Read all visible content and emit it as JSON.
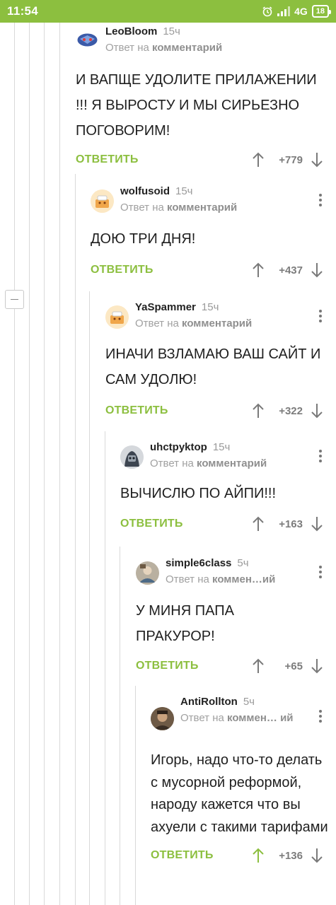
{
  "status_bar": {
    "time": "11:54",
    "network": "4G",
    "battery": "18"
  },
  "comments": [
    {
      "nick": "LeoBloom",
      "time": "15ч",
      "reply_prefix": "Ответ на",
      "reply_target": "комментарий",
      "text": "И ВАПЩЕ УДОЛИТЕ ПРИЛАЖЕНИИ !!! Я ВЫРОСТУ И МЫ СИРЬЕЗНО ПОГОВОРИМ!",
      "reply_label": "ОТВЕТИТЬ",
      "rating": "+779"
    },
    {
      "nick": "wolfusoid",
      "time": "15ч",
      "reply_prefix": "Ответ на",
      "reply_target": "комментарий",
      "text": "ДОЮ ТРИ ДНЯ!",
      "reply_label": "ОТВЕТИТЬ",
      "rating": "+437"
    },
    {
      "nick": "YaSpammer",
      "time": "15ч",
      "reply_prefix": "Ответ на",
      "reply_target": "комментарий",
      "text": "ИНАЧИ ВЗЛАМАЮ ВАШ САЙТ И САМ УДОЛЮ!",
      "reply_label": "ОТВЕТИТЬ",
      "rating": "+322"
    },
    {
      "nick": "uhctpyktop",
      "time": "15ч",
      "reply_prefix": "Ответ на",
      "reply_target": "комментарий",
      "text": "ВЫЧИСЛЮ ПО АЙПИ!!!",
      "reply_label": "ОТВЕТИТЬ",
      "rating": "+163"
    },
    {
      "nick": "simple6class",
      "time": "5ч",
      "reply_prefix": "Ответ на",
      "reply_target": "коммен…ий",
      "text": "У МИНЯ ПАПА ПРАКУРОР!",
      "reply_label": "ОТВЕТИТЬ",
      "rating": "+65"
    },
    {
      "nick": "AntiRollton",
      "time": "5ч",
      "reply_prefix": "Ответ на",
      "reply_target": "коммен… ий",
      "text": "Игорь, надо что-то делать с мусорной реформой, народу кажется что вы ахуели с такими тарифами",
      "reply_label": "ОТВЕТИТЬ",
      "rating": "+136"
    }
  ]
}
